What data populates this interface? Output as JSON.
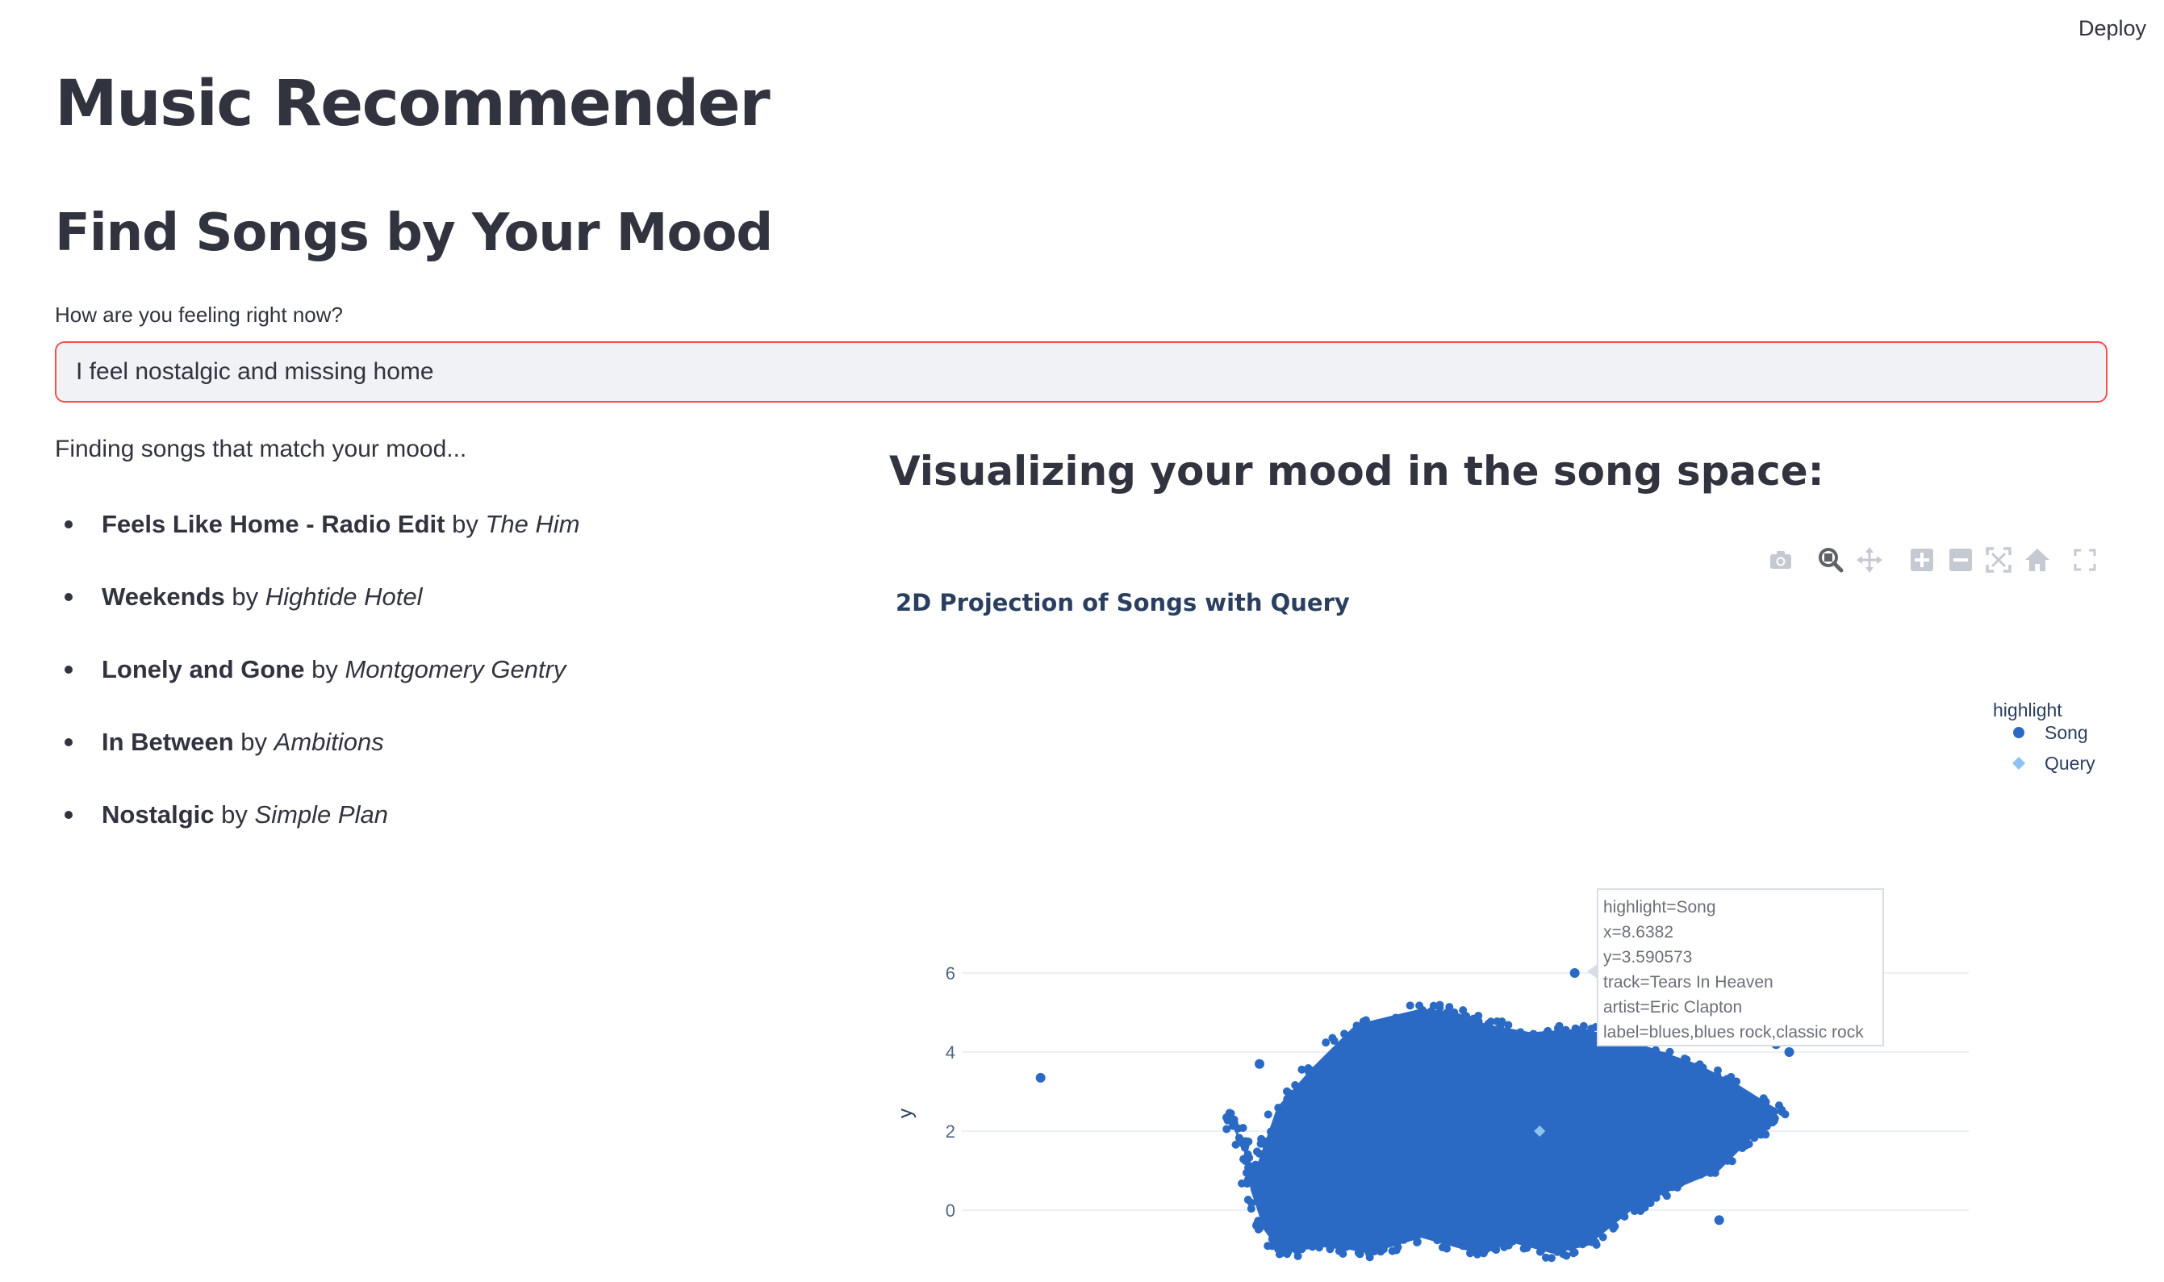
{
  "header": {
    "deploy_label": "Deploy"
  },
  "app": {
    "title": "Music Recommender",
    "subtitle": "Find Songs by Your Mood"
  },
  "mood_input": {
    "label": "How are you feeling right now?",
    "value": "I feel nostalgic and missing home"
  },
  "results": {
    "status": "Finding songs that match your mood...",
    "by_word": "by",
    "songs": [
      {
        "track": "Feels Like Home - Radio Edit",
        "artist": "The Him"
      },
      {
        "track": "Weekends",
        "artist": "Hightide Hotel"
      },
      {
        "track": "Lonely and Gone",
        "artist": "Montgomery Gentry"
      },
      {
        "track": "In Between",
        "artist": "Ambitions"
      },
      {
        "track": "Nostalgic",
        "artist": "Simple Plan"
      }
    ]
  },
  "visualization": {
    "heading": "Visualizing your mood in the song space:",
    "modebar_icons": [
      "camera-icon",
      "zoom-icon",
      "pan-icon",
      "zoom-in-icon",
      "zoom-out-icon",
      "autoscale-icon",
      "reset-axes-icon",
      "fullscreen-icon"
    ]
  },
  "tooltip": {
    "lines": [
      "highlight=Song",
      "x=8.6382",
      "y=3.590573",
      "track=Tears In Heaven",
      "artist=Eric Clapton",
      "label=blues,blues rock,classic rock"
    ]
  },
  "colors": {
    "song": "#2b6ac4",
    "query": "#8fc2ee",
    "input_border": "#ff4b4b",
    "input_bg": "#f0f2f6",
    "text": "#31333f"
  },
  "chart_data": {
    "type": "scatter",
    "title": "2D Projection of Songs with Query",
    "ylabel": "y",
    "yticks": [
      0,
      2,
      4,
      6
    ],
    "legend": {
      "title": "highlight",
      "position": "top-right",
      "entries": [
        "Song",
        "Query"
      ]
    },
    "series": [
      {
        "name": "Song",
        "marker": "circle",
        "outliers": [
          [
            -2.2,
            3.35
          ],
          [
            13.8,
            6.7
          ],
          [
            14.2,
            6.2
          ],
          [
            11.0,
            5.6
          ],
          [
            13.6,
            5.2
          ],
          [
            14.1,
            5.0
          ],
          [
            13.1,
            5.5
          ],
          [
            12.6,
            5.4
          ],
          [
            14.6,
            4.2
          ],
          [
            14.9,
            4.0
          ],
          [
            2.8,
            3.7
          ],
          [
            13.3,
            -0.25
          ],
          [
            10.0,
            6.0
          ]
        ],
        "cloud": [
          [
            2.0,
            2.5
          ],
          [
            2.7,
            1.0
          ],
          [
            3.2,
            2.6
          ],
          [
            4.0,
            3.6
          ],
          [
            5.0,
            4.7
          ],
          [
            6.5,
            5.1
          ],
          [
            7.3,
            5.0
          ],
          [
            8.0,
            4.7
          ],
          [
            9.0,
            4.5
          ],
          [
            10.2,
            4.6
          ],
          [
            11.5,
            4.2
          ],
          [
            12.8,
            3.7
          ],
          [
            13.7,
            3.2
          ],
          [
            14.7,
            2.5
          ],
          [
            14.2,
            2.0
          ],
          [
            13.3,
            1.0
          ],
          [
            12.0,
            0.4
          ],
          [
            11.3,
            0.0
          ],
          [
            10.3,
            -0.9
          ],
          [
            9.5,
            -1.1
          ],
          [
            8.5,
            -0.8
          ],
          [
            7.8,
            -1.1
          ],
          [
            6.5,
            -0.7
          ],
          [
            5.3,
            -1.1
          ],
          [
            4.4,
            -0.9
          ],
          [
            3.3,
            -1.1
          ],
          [
            2.9,
            -0.5
          ],
          [
            2.6,
            0.5
          ],
          [
            2.4,
            1.8
          ]
        ]
      },
      {
        "name": "Query",
        "marker": "diamond",
        "points": [
          [
            9.2,
            2.0
          ]
        ]
      }
    ]
  }
}
